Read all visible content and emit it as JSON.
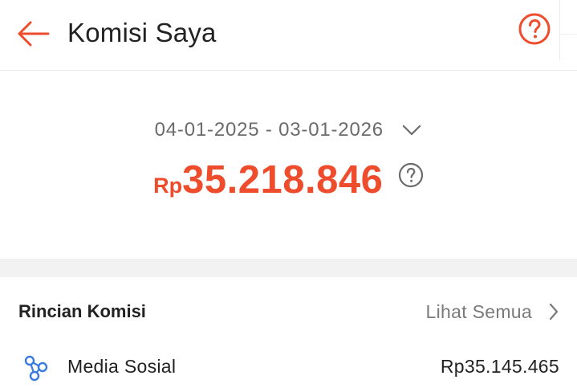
{
  "header": {
    "title": "Komisi Saya",
    "back_icon": "arrow-left-icon",
    "help_icon": "question-circle-icon"
  },
  "summary": {
    "date_range": "04-01-2025 - 03-01-2026",
    "currency": "Rp",
    "amount": "35.218.846"
  },
  "details": {
    "title": "Rincian Komisi",
    "see_all_label": "Lihat Semua",
    "rows": [
      {
        "icon": "share-network-icon",
        "label": "Media Sosial",
        "value": "Rp35.145.465"
      }
    ]
  },
  "colors": {
    "accent": "#ee4d2d",
    "text": "#222222",
    "muted": "#6b6b6b",
    "icon_blue": "#3b7be0",
    "divider_bg": "#f2f2f2"
  }
}
